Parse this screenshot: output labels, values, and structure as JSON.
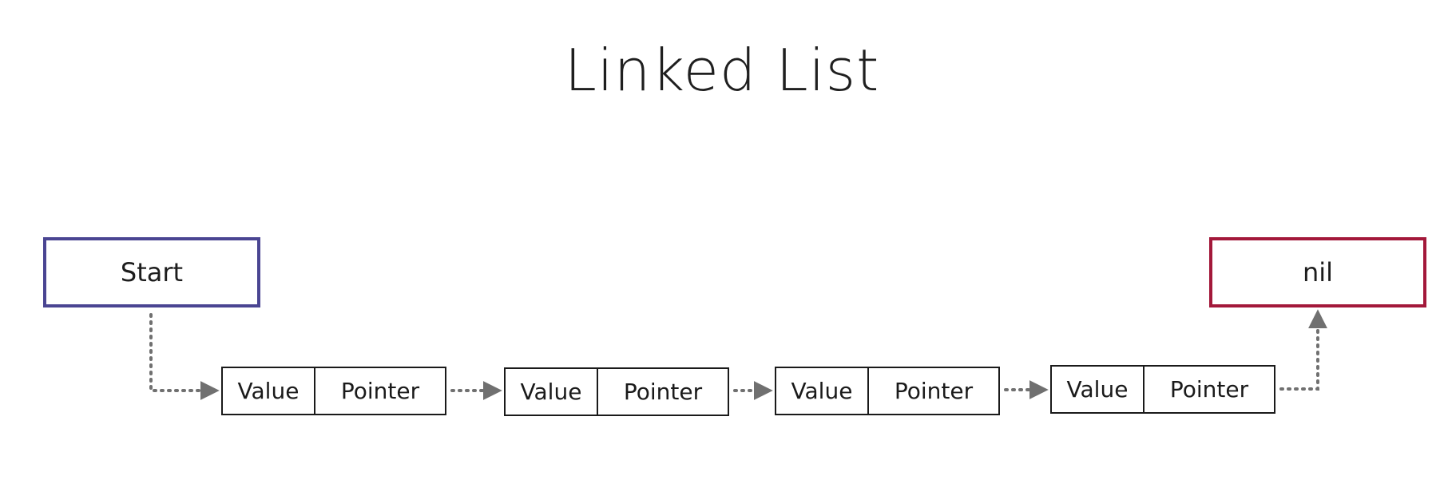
{
  "title": "Linked List",
  "start_label": "Start",
  "end_label": "nil",
  "nodes": [
    {
      "value_label": "Value",
      "pointer_label": "Pointer"
    },
    {
      "value_label": "Value",
      "pointer_label": "Pointer"
    },
    {
      "value_label": "Value",
      "pointer_label": "Pointer"
    },
    {
      "value_label": "Value",
      "pointer_label": "Pointer"
    }
  ],
  "colors": {
    "start_border": "#4a4592",
    "end_border": "#a3183a",
    "connector": "#707070"
  }
}
